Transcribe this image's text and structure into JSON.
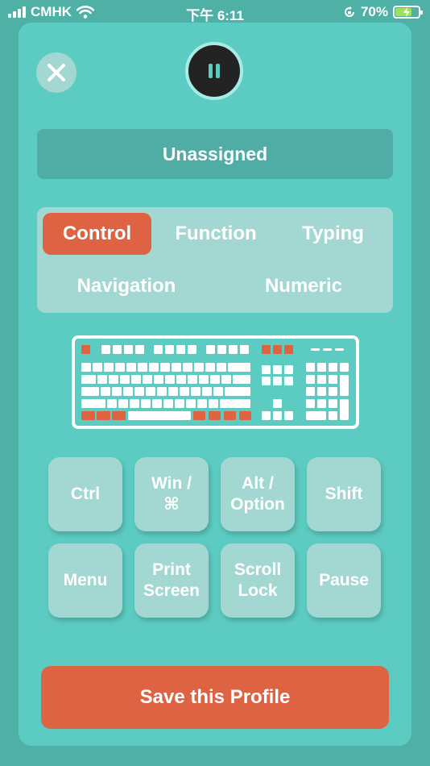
{
  "status_bar": {
    "carrier": "CMHK",
    "time": "下午 6:11",
    "battery": "70%",
    "battery_level": 0.7,
    "icons": [
      "signal-icon",
      "wifi-icon",
      "orientation-lock-icon",
      "battery-charging-icon"
    ]
  },
  "header": {
    "close_icon": "close-icon",
    "pause_icon": "pause-icon"
  },
  "profile": {
    "name": "Unassigned"
  },
  "categories": {
    "items": [
      "Control",
      "Function",
      "Typing",
      "Navigation",
      "Numeric"
    ],
    "selected": "Control"
  },
  "keyboard_preview": {
    "icon": "keyboard-icon",
    "highlight_color": "#dd6342",
    "key_color": "#ffffff"
  },
  "keys": [
    "Ctrl",
    "Win /\n⌘",
    "Alt /\nOption",
    "Shift",
    "Menu",
    "Print\nScreen",
    "Scroll\nLock",
    "Pause"
  ],
  "save": {
    "label": "Save this Profile"
  },
  "colors": {
    "background": "#4fb0a6",
    "panel": "#5ccbc1",
    "accent": "#dd6342",
    "button": "#a3d8d2"
  }
}
